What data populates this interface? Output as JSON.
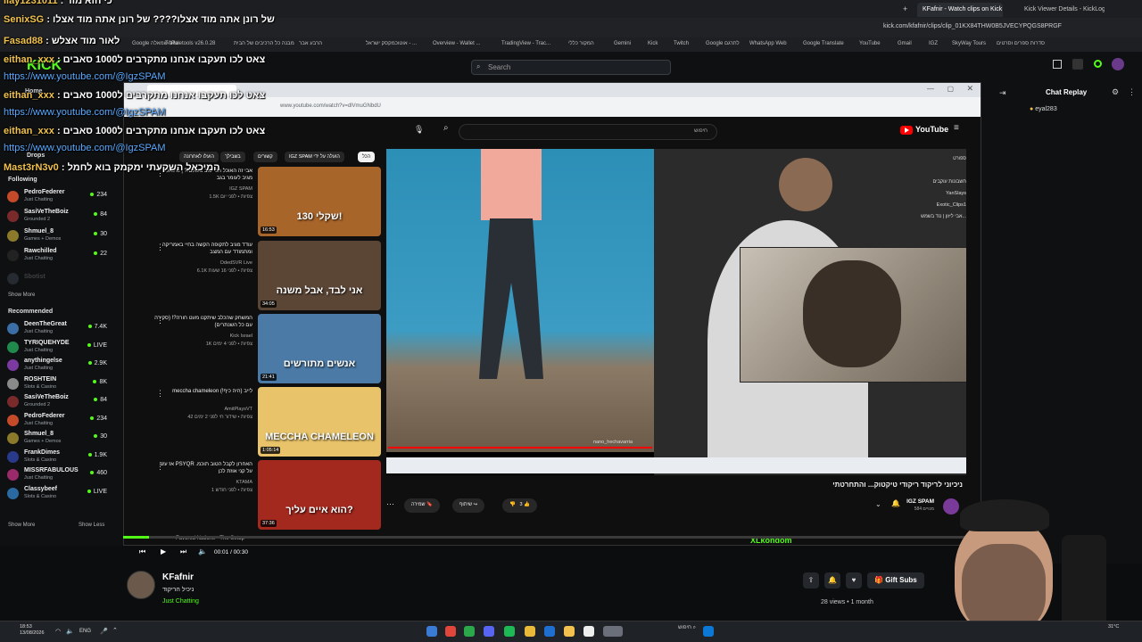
{
  "outer_browser": {
    "tabs": [
      "KFafnir - Watch clips on Kick",
      "Kick Viewer Details - KickLogs"
    ],
    "url": "kick.com/kfafnir/clips/clip_01KX84THW0B5JVECYPQGS8PRGF",
    "bookmarks": [
      "Google ל-שמאלה",
      "Trello",
      "Paletools v26.0.28",
      "מבנה כל הרכיבים של הבית",
      "הרבע אבר",
      "אוטוכמקסק ישראל - ...",
      "Overview - Wallet ...",
      "TradingView - Trac...",
      "המקור כללי",
      "Gemini",
      "Kick",
      "Twitch",
      "Google לתרגם",
      "WhatsApp Web",
      "Google Translate",
      "YouTube",
      "Gmail",
      "IGZ",
      "SkyWay Tours",
      "סדרות ספרים וסרטים"
    ]
  },
  "kick": {
    "search_placeholder": "Search",
    "sidebar": {
      "home": "Home",
      "drops": "Drops",
      "following_title": "Following",
      "following": [
        {
          "name": "PedroFederer",
          "cat": "Just Chatting",
          "count": "234"
        },
        {
          "name": "SasiVeTheBoiz",
          "cat": "Grounded 2",
          "count": "84"
        },
        {
          "name": "Shmuel_8",
          "cat": "Games + Demos",
          "count": "30"
        },
        {
          "name": "Rawchilled",
          "cat": "Just Chatting",
          "count": "22"
        },
        {
          "name": "Sbotist",
          "cat": "",
          "count": ""
        }
      ],
      "show_more": "Show More",
      "recommended_title": "Recommended",
      "recommended": [
        {
          "name": "DeenTheGreat",
          "cat": "Just Chatting",
          "count": "7.4K"
        },
        {
          "name": "TYRIQUEHYDE",
          "cat": "Just Chatting",
          "count": "LIVE"
        },
        {
          "name": "anythingelse",
          "cat": "Just Chatting",
          "count": "2.9K"
        },
        {
          "name": "ROSHTEIN",
          "cat": "Slots & Casino",
          "count": "8K"
        },
        {
          "name": "SasiVeTheBoiz",
          "cat": "Grounded 2",
          "count": "84"
        },
        {
          "name": "PedroFederer",
          "cat": "Just Chatting",
          "count": "234"
        },
        {
          "name": "Shmuel_8",
          "cat": "Games + Demos",
          "count": "30"
        },
        {
          "name": "FrankDimes",
          "cat": "Slots & Casino",
          "count": "1.9K"
        },
        {
          "name": "MISSRFABULOUS",
          "cat": "Just Chatting",
          "count": "460"
        },
        {
          "name": "Classybeef",
          "cat": "Slots & Casino",
          "count": "LIVE"
        }
      ],
      "show_more_2": "Show More",
      "show_less": "Show Less"
    },
    "chat": {
      "title": "Chat Replay",
      "viewer_badge": "eyal283"
    },
    "clip": {
      "time": "00:01 / 00:30",
      "progress": 0.03,
      "streamer": "KFafnir",
      "title": "ניכיל הריקוד",
      "category": "Just Chatting",
      "views": "28 views • 1 month",
      "gift_label": "Gift Subs",
      "favored_label": "Favored Nations - The Setup",
      "xl_user": "XLkondom"
    }
  },
  "overlay_chat": [
    {
      "user": "llay1231011",
      "text": ": כי הוא מוד"
    },
    {
      "user": "SenixSG",
      "text": ": של רונן אתה מוד אצלו???? של רונן אתה מוד אצלו"
    },
    {
      "user": "Fasad88",
      "text": ": לאור מוד אצלש"
    },
    {
      "user": "eithan_xxx",
      "text": ": צאט לכו תעקבו אנחנו מתקרבים ל1000 סאבים"
    },
    {
      "user": "",
      "text": "https://www.youtube.com/@IgzSPAM"
    },
    {
      "user": "eithan_xxx",
      "text": ": צאט לכו תעקבו אנחנו מתקרבים ל1000 סאבים"
    },
    {
      "user": "",
      "text": "https://www.youtube.com/@IgzSPAM"
    },
    {
      "user": "eithan_xxx",
      "text": ": צאט לכו תעקבו אנחנו מתקרבים ל1000 סאבים"
    },
    {
      "user": "",
      "text": "https://www.youtube.com/@IgzSPAM"
    },
    {
      "user": "Mast3rN3v0",
      "text": ": המיכאל השקעתי ימקמק בוא לחמל"
    }
  ],
  "youtube": {
    "url": "www.youtube.com/watch?v=dlVmuGNbdU",
    "search_text": "חיפוש",
    "logo": "YouTube",
    "chips": [
      "הכל",
      "IGZ SPAM הועלה על ידי",
      "קשורים",
      "בשבילך",
      "הועלו לאחרונה"
    ],
    "recs": [
      {
        "title": "אבי זה האוכל הכי טוב בעולם!? | מיכאל מגיב לעומר בגב",
        "channel": "IGZ SPAM",
        "meta": "1.5K צפיות • לפני יום",
        "duration": "16:53",
        "thumb_text": "130 שקלי!",
        "thumb_color": "#a8652a"
      },
      {
        "title": "עודד מגיב לתקופה הקשה בחיי באמריקה ומתמודד עם המצב",
        "channel": "OdedSVR Live",
        "meta": "6.1K צפיות • לפני 16 שעות",
        "duration": "34:05",
        "thumb_text": "אני לבד, אבל משנה",
        "thumb_color": "#5b4636"
      },
      {
        "title": "המשחק שהכלב שיתקנו מעט חורה?! (סקירה עם כל השנתרים)",
        "channel": "Kick Israel",
        "meta": "1K צפיות • לפני 4 ימים",
        "duration": "21:41",
        "thumb_text": "אנשים מתורשים",
        "thumb_color": "#4b7aa6"
      },
      {
        "title": "meccha chameleon לייב (היה כיף!)",
        "channel": "AmitPlaysVT",
        "meta": "42 צפיות • שידור חי לפני 2 ימים",
        "duration": "1:05:14",
        "thumb_text": "MECCHA CHAMELEON",
        "thumb_color": "#e8c36a"
      },
      {
        "title": "אז עזב PSYQR האחרון לקבל הטוב תוכמ. על קני אוזת לכן",
        "channel": "KTAMA",
        "meta": "1 צפיות • לפני חודש",
        "duration": "37:36",
        "thumb_text": "הוא איים עליך?",
        "thumb_color": "#a3291f"
      }
    ],
    "mini_list": [
      "ספורט",
      "חשבונות עוקבים",
      "YanSlays",
      "Exotic_Clips1",
      "אבי ליזון | נוד בשמש..."
    ],
    "video_channel_overlay": "nano_hechavarria",
    "video_title": "ניכיוני לריקוד ריקודי טיקטוק... והתחרטתי",
    "channel_name": "IGZ SPAM",
    "channel_subs": "584 מנויים",
    "actions": {
      "share": "שיתוף",
      "save": "שמירה",
      "likes": "3"
    }
  },
  "taskbar": {
    "time": "18:53",
    "date": "13/08/2026",
    "lang": "ENG",
    "search": "חיפוש",
    "weather": "31°C"
  },
  "colors": {
    "kick_green": "#53fc18",
    "yt_red": "#ff0000",
    "overlay_user": "#f1c24d",
    "link": "#5aa9ff"
  }
}
